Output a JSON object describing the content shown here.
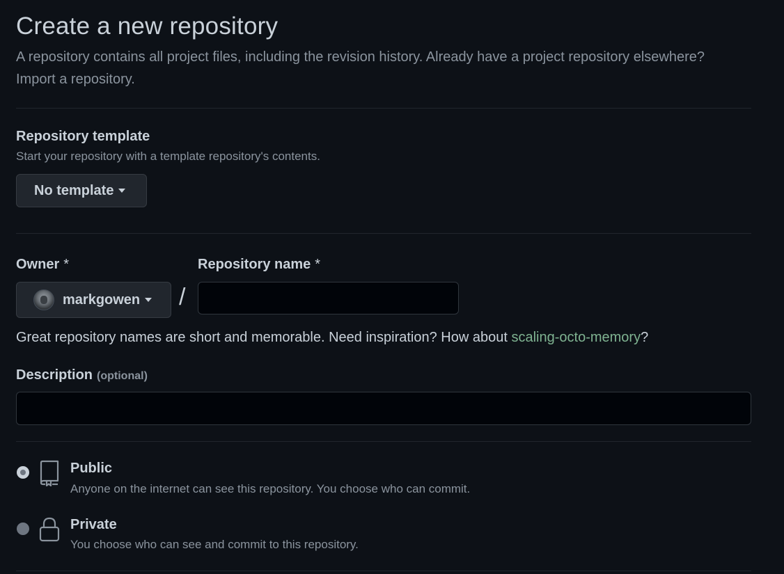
{
  "header": {
    "title": "Create a new repository",
    "subtitle": "A repository contains all project files, including the revision history. Already have a project repository elsewhere?",
    "import_link": "Import a repository."
  },
  "template": {
    "label": "Repository template",
    "help": "Start your repository with a template repository's contents.",
    "button_label": "No template"
  },
  "owner": {
    "label": "Owner",
    "required_mark": "*",
    "selected": "markgowen"
  },
  "slash": "/",
  "repo_name": {
    "label": "Repository name",
    "required_mark": "*",
    "value": ""
  },
  "name_hint": {
    "prefix": "Great repository names are short and memorable. Need inspiration? How about ",
    "suggestion": "scaling-octo-memory",
    "suffix": "?"
  },
  "description": {
    "label": "Description",
    "optional": "(optional)",
    "value": ""
  },
  "visibility": {
    "options": [
      {
        "title": "Public",
        "description": "Anyone on the internet can see this repository. You choose who can commit.",
        "checked": true,
        "icon": "repo-icon"
      },
      {
        "title": "Private",
        "description": "You choose who can see and commit to this repository.",
        "checked": false,
        "icon": "lock-icon"
      }
    ]
  },
  "colors": {
    "background": "#0d1117",
    "text": "#c9d1d9",
    "muted": "#8b949e",
    "suggestion": "#7fb391",
    "border": "#30363d",
    "button_bg": "#21262d",
    "input_bg": "#010409"
  }
}
